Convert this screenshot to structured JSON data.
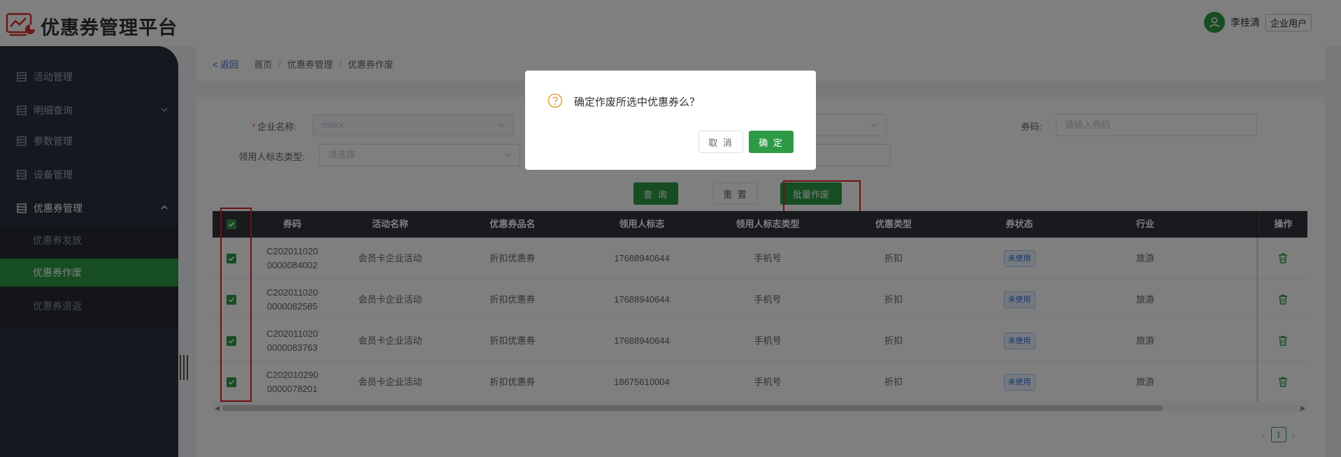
{
  "app": {
    "title": "优惠券管理平台"
  },
  "user": {
    "name": "李桂清",
    "role": "企业用户"
  },
  "sidebar": {
    "items": [
      {
        "label": "活动管理",
        "has_arrow": false
      },
      {
        "label": "明细查询",
        "has_arrow": true
      },
      {
        "label": "参数管理",
        "has_arrow": false
      },
      {
        "label": "设备管理",
        "has_arrow": false
      },
      {
        "label": "优惠券管理",
        "has_arrow": true,
        "open": true
      }
    ],
    "sub_items": [
      {
        "label": "优惠券发放",
        "active": false
      },
      {
        "label": "优惠券作废",
        "active": true
      },
      {
        "label": "优惠券退返",
        "active": false
      }
    ]
  },
  "breadcrumb": {
    "back": "< 返回",
    "items": [
      "首页",
      "优惠券管理",
      "优惠券作废"
    ]
  },
  "form": {
    "company_label": "企业名称:",
    "company_value": "moxx",
    "coupon_code_label": "券码:",
    "coupon_code_placeholder": "请输入券码",
    "holder_type_label": "领用人标志类型:",
    "holder_type_placeholder": "请选择"
  },
  "buttons": {
    "query": "查 询",
    "reset": "重 置",
    "batch_void": "批量作废"
  },
  "table": {
    "headers": [
      "券码",
      "活动名称",
      "优惠券品名",
      "领用人标志",
      "领用人标志类型",
      "优惠类型",
      "券状态",
      "行业",
      "操作"
    ],
    "rows": [
      {
        "code_line1": "C202011020",
        "code_line2": "0000084002",
        "activity": "会员卡企业活动",
        "product": "折扣优惠券",
        "holder": "17688940644",
        "holder_type": "手机号",
        "discount_type": "折扣",
        "status": "未使用",
        "industry": "旅游"
      },
      {
        "code_line1": "C202011020",
        "code_line2": "0000082585",
        "activity": "会员卡企业活动",
        "product": "折扣优惠券",
        "holder": "17688940644",
        "holder_type": "手机号",
        "discount_type": "折扣",
        "status": "未使用",
        "industry": "旅游"
      },
      {
        "code_line1": "C202011020",
        "code_line2": "0000083763",
        "activity": "会员卡企业活动",
        "product": "折扣优惠券",
        "holder": "17688940644",
        "holder_type": "手机号",
        "discount_type": "折扣",
        "status": "未使用",
        "industry": "旅游"
      },
      {
        "code_line1": "C202010290",
        "code_line2": "0000078201",
        "activity": "会员卡企业活动",
        "product": "折扣优惠券",
        "holder": "18675610004",
        "holder_type": "手机号",
        "discount_type": "折扣",
        "status": "未使用",
        "industry": "旅游"
      }
    ]
  },
  "pagination": {
    "current": "1"
  },
  "dialog": {
    "message": "确定作废所选中优惠券么？",
    "cancel": "取 消",
    "confirm": "确 定"
  },
  "icons": {
    "logo": "chart-card-icon",
    "menu": "list-box-icon",
    "delete": "trash-icon",
    "dialog": "question-circle-icon"
  },
  "colors": {
    "accent": "#2e9a46",
    "sidebar": "#2b313d",
    "table_header": "#30343c",
    "tag_blue": "#2f6bd6",
    "warning": "#e6a23c",
    "highlight": "#e02020"
  }
}
